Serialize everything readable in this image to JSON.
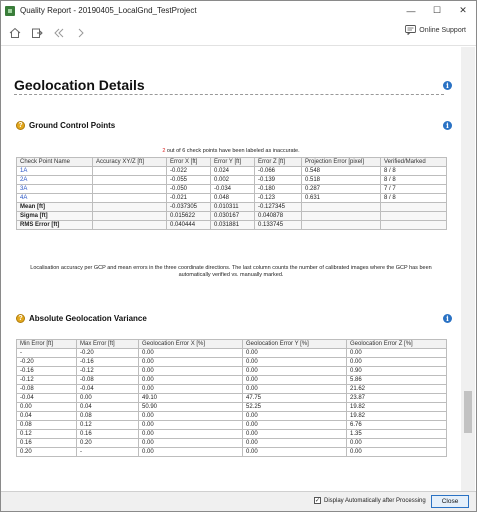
{
  "window": {
    "title": "Quality Report - 20190405_LocalGnd_TestProject",
    "minimize": "—",
    "maximize": "☐",
    "close": "✕"
  },
  "toolbar": {
    "online_support": "Online Support"
  },
  "report": {
    "section_title": "Geolocation Details",
    "info_glyph": "i",
    "help_glyph": "?",
    "gcp": {
      "title": "Ground Control Points",
      "note_count": "2",
      "note_rest": " out of 6 check points have been labeled as inaccurate.",
      "headers": [
        "Check Point Name",
        "Accuracy XY/Z [ft]",
        "Error X [ft]",
        "Error Y [ft]",
        "Error Z [ft]",
        "Projection Error [pixel]",
        "Verified/Marked"
      ],
      "rows": [
        [
          "1A",
          "",
          "-0.022",
          "0.024",
          "-0.066",
          "0.548",
          "8 / 8"
        ],
        [
          "2A",
          "",
          "-0.055",
          "0.002",
          "-0.139",
          "0.518",
          "8 / 8"
        ],
        [
          "3A",
          "",
          "-0.050",
          "-0.034",
          "-0.180",
          "0.287",
          "7 / 7"
        ],
        [
          "4A",
          "",
          "-0.021",
          "0.048",
          "-0.123",
          "0.631",
          "8 / 8"
        ]
      ],
      "stats": [
        [
          "Mean [ft]",
          "",
          "-0.037305",
          "0.010311",
          "-0.127345",
          "",
          ""
        ],
        [
          "Sigma [ft]",
          "",
          "0.015622",
          "0.030167",
          "0.040878",
          "",
          ""
        ],
        [
          "RMS Error [ft]",
          "",
          "0.040444",
          "0.031881",
          "0.133745",
          "",
          ""
        ]
      ],
      "caption": "Localisation accuracy per GCP and mean errors in the three coordinate directions. The last column counts the number of calibrated images where the GCP has been automatically verified vs. manually marked."
    },
    "absolute": {
      "title": "Absolute Geolocation Variance",
      "headers": [
        "Min Error [ft]",
        "Max Error [ft]",
        "Geolocation Error X [%]",
        "Geolocation Error Y [%]",
        "Geolocation Error Z [%]"
      ],
      "rows": [
        [
          "-",
          "-0.20",
          "0.00",
          "0.00",
          "0.00"
        ],
        [
          "-0.20",
          "-0.16",
          "0.00",
          "0.00",
          "0.00"
        ],
        [
          "-0.16",
          "-0.12",
          "0.00",
          "0.00",
          "0.90"
        ],
        [
          "-0.12",
          "-0.08",
          "0.00",
          "0.00",
          "5.86"
        ],
        [
          "-0.08",
          "-0.04",
          "0.00",
          "0.00",
          "21.62"
        ],
        [
          "-0.04",
          "0.00",
          "49.10",
          "47.75",
          "23.87"
        ],
        [
          "0.00",
          "0.04",
          "50.90",
          "52.25",
          "19.82"
        ],
        [
          "0.04",
          "0.08",
          "0.00",
          "0.00",
          "19.82"
        ],
        [
          "0.08",
          "0.12",
          "0.00",
          "0.00",
          "6.76"
        ],
        [
          "0.12",
          "0.16",
          "0.00",
          "0.00",
          "1.35"
        ],
        [
          "0.16",
          "0.20",
          "0.00",
          "0.00",
          "0.00"
        ],
        [
          "0.20",
          "-",
          "0.00",
          "0.00",
          "0.00"
        ]
      ]
    }
  },
  "footer": {
    "display_auto_label": "Display Automatically after Processing",
    "display_auto_checked": true,
    "check_glyph": "✓",
    "close_label": "Close"
  },
  "colors": {
    "link": "#2a56c6",
    "info": "#2a72c4",
    "help": "#e3a81e",
    "inaccurate_count": "#dd2222"
  }
}
